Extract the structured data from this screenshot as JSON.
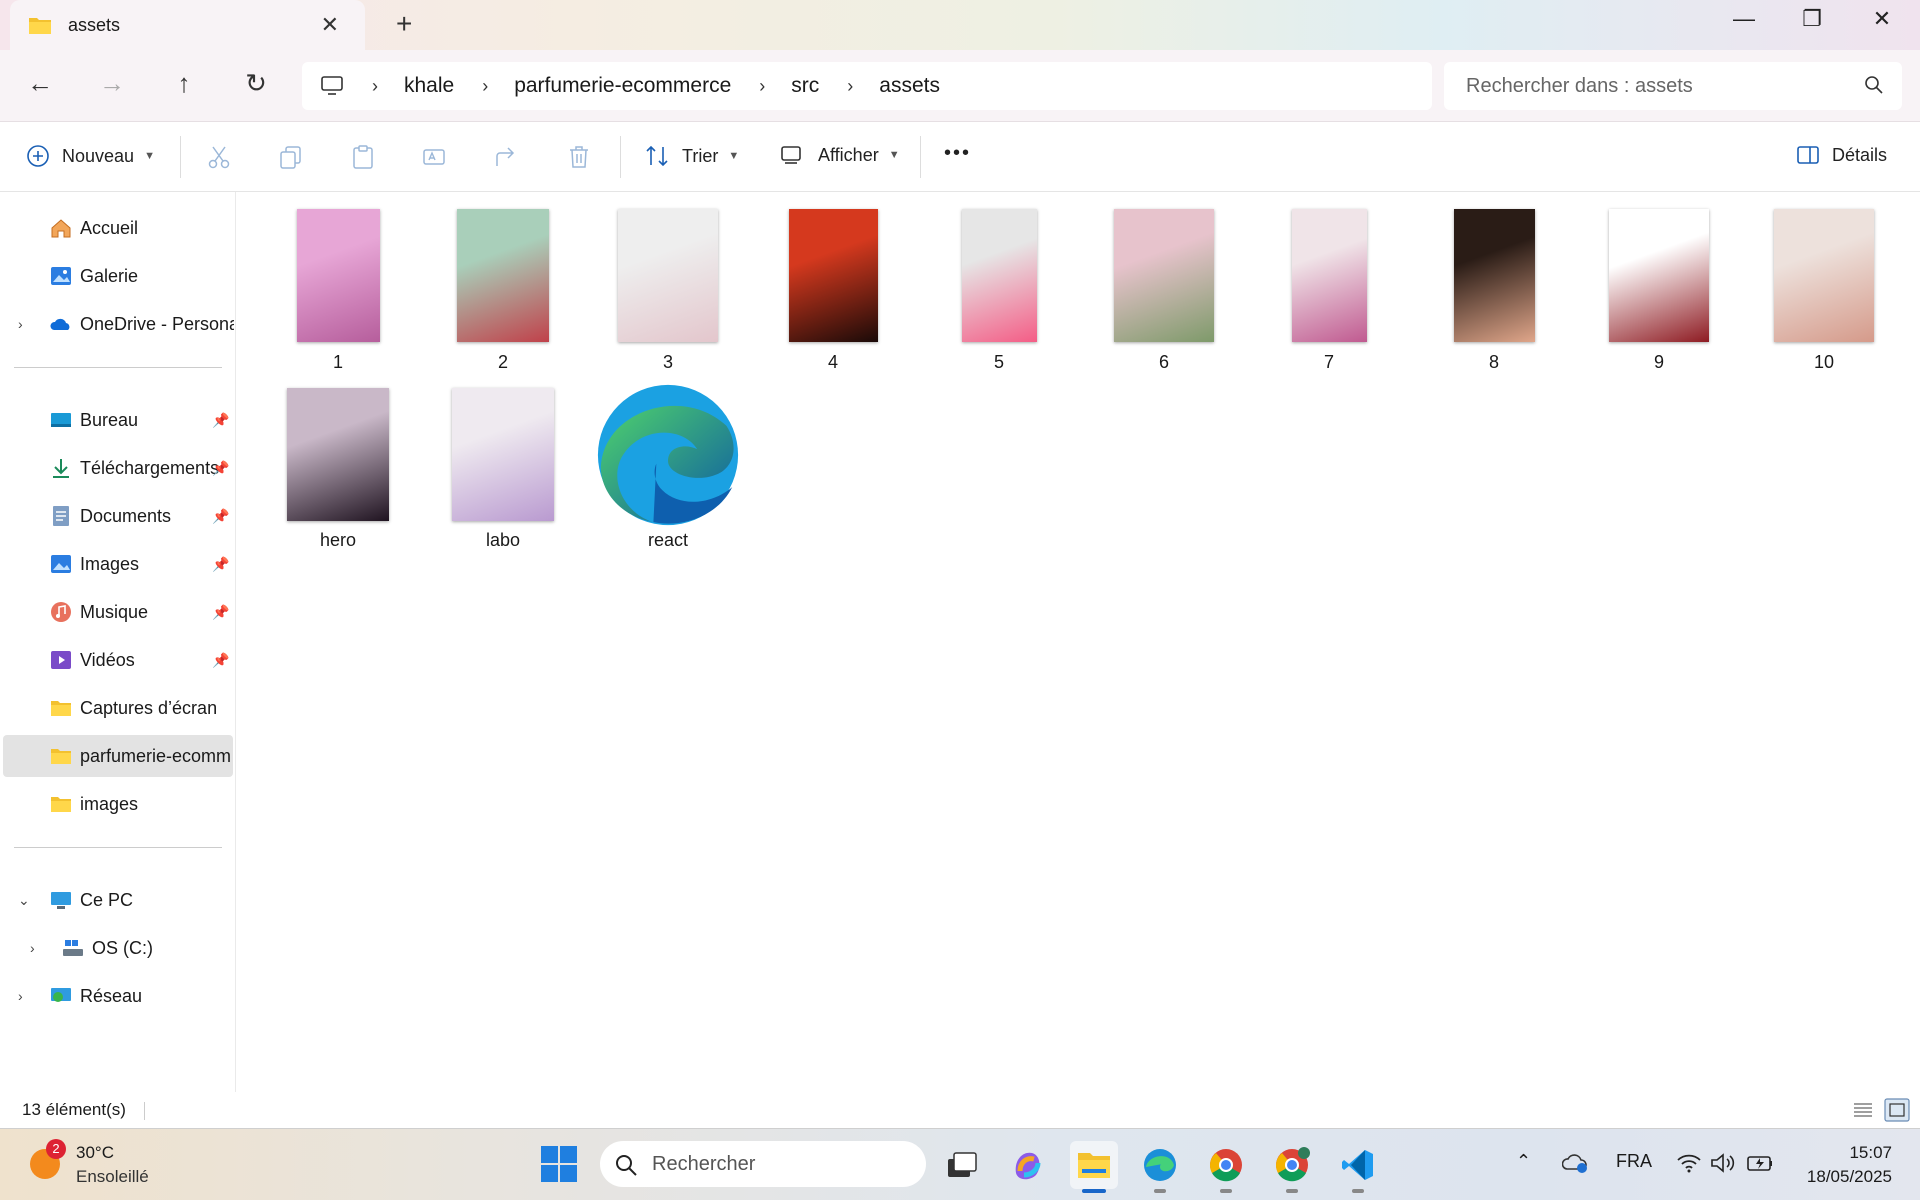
{
  "window": {
    "tab_title": "assets",
    "new_tab": "+",
    "minimize": "—",
    "maximize": "❐",
    "close": "✕"
  },
  "nav": {
    "breadcrumbs": [
      "khale",
      "parfumerie-ecommerce",
      "src",
      "assets"
    ],
    "search_placeholder": "Rechercher dans : assets"
  },
  "toolbar": {
    "new_label": "Nouveau",
    "sort_label": "Trier",
    "view_label": "Afficher",
    "more_label": "•••",
    "details_label": "Détails"
  },
  "sidebar": {
    "quick": [
      {
        "label": "Accueil",
        "icon": "home-icon"
      },
      {
        "label": "Galerie",
        "icon": "gallery-icon"
      },
      {
        "label": "OneDrive - Persona",
        "icon": "onedrive-icon"
      }
    ],
    "pinned": [
      {
        "label": "Bureau",
        "icon": "desktop-icon"
      },
      {
        "label": "Téléchargements",
        "icon": "download-icon"
      },
      {
        "label": "Documents",
        "icon": "documents-icon"
      },
      {
        "label": "Images",
        "icon": "pictures-icon"
      },
      {
        "label": "Musique",
        "icon": "music-icon"
      },
      {
        "label": "Vidéos",
        "icon": "videos-icon"
      },
      {
        "label": "Captures d’écran",
        "icon": "folder-icon"
      },
      {
        "label": "parfumerie-ecomm",
        "icon": "folder-icon"
      },
      {
        "label": "images",
        "icon": "folder-icon"
      }
    ],
    "devices": [
      {
        "label": "Ce PC",
        "icon": "pc-icon"
      },
      {
        "label": "OS (C:)",
        "icon": "drive-icon"
      },
      {
        "label": "Réseau",
        "icon": "network-icon"
      }
    ],
    "selected": "parfumerie-ecomm"
  },
  "files": [
    {
      "name": "1",
      "kind": "image",
      "colors": [
        "#e7a6d6",
        "#b65e9c"
      ]
    },
    {
      "name": "2",
      "kind": "image",
      "colors": [
        "#a9cfba",
        "#c0414a"
      ]
    },
    {
      "name": "3",
      "kind": "image",
      "colors": [
        "#eeeeee",
        "#e3c6cc"
      ]
    },
    {
      "name": "4",
      "kind": "image",
      "colors": [
        "#d5391e",
        "#1a0a08"
      ]
    },
    {
      "name": "5",
      "kind": "image",
      "colors": [
        "#e6e6e6",
        "#f45d86"
      ]
    },
    {
      "name": "6",
      "kind": "image",
      "colors": [
        "#e7c3cc",
        "#7e9a6a"
      ]
    },
    {
      "name": "7",
      "kind": "image",
      "colors": [
        "#f0e4e8",
        "#c05a90"
      ]
    },
    {
      "name": "8",
      "kind": "image",
      "colors": [
        "#2a1c16",
        "#e0a68a"
      ]
    },
    {
      "name": "9",
      "kind": "image",
      "colors": [
        "#ffffff",
        "#8e1b22"
      ]
    },
    {
      "name": "10",
      "kind": "image",
      "colors": [
        "#ede1dc",
        "#d59a8a"
      ]
    },
    {
      "name": "hero",
      "kind": "image",
      "colors": [
        "#c9b8c8",
        "#1f1320"
      ]
    },
    {
      "name": "labo",
      "kind": "image",
      "colors": [
        "#efeaf0",
        "#b99ad0"
      ]
    },
    {
      "name": "react",
      "kind": "edge-logo",
      "colors": [
        "#1ba1e2",
        "#4fd36b"
      ]
    }
  ],
  "status": {
    "count": "13 élément(s)"
  },
  "taskbar": {
    "weather_badge": "2",
    "weather_temp": "30°C",
    "weather_desc": "Ensoleillé",
    "search_placeholder": "Rechercher",
    "language": "FRA",
    "time": "15:07",
    "date": "18/05/2025"
  }
}
